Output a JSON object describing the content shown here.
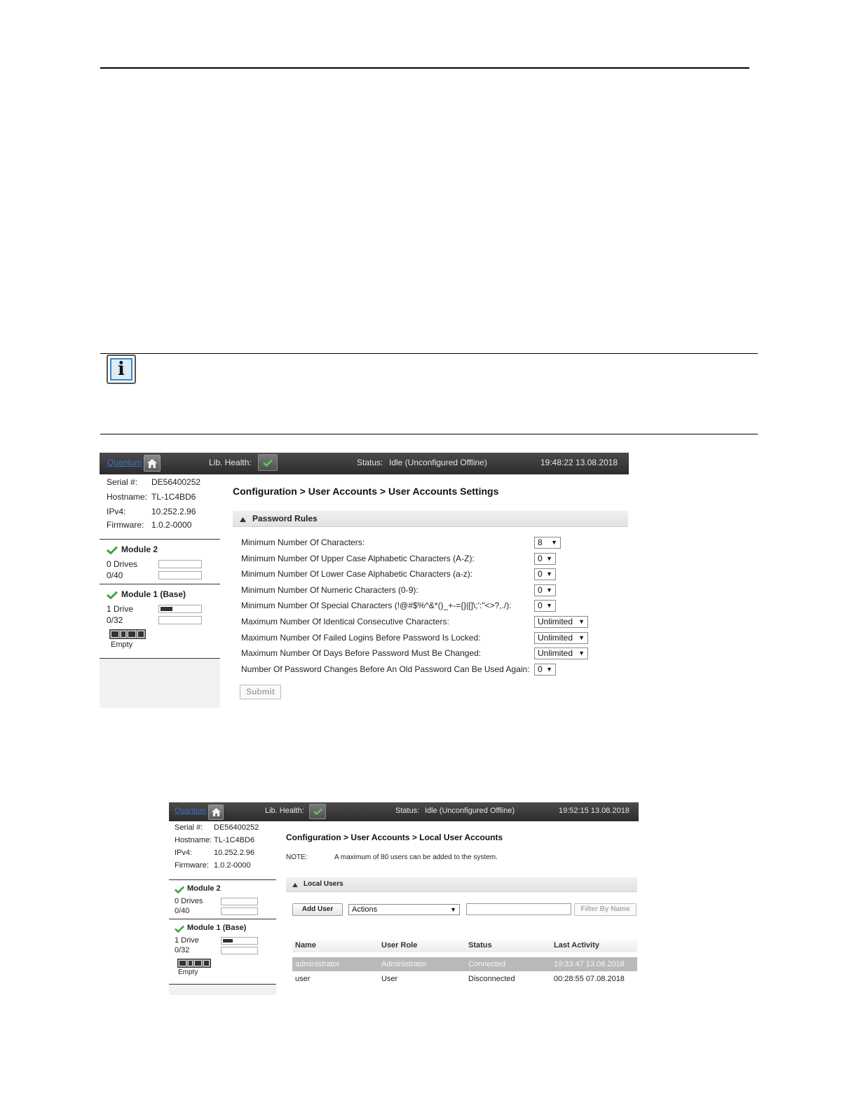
{
  "info_icon": {
    "glyph": "i"
  },
  "screen1": {
    "topbar": {
      "logo": "Quantum",
      "health_label": "Lib. Health:",
      "status_label": "Status:",
      "status_value": "Idle (Unconfigured Offline)",
      "datetime": "19:48:22  13.08.2018"
    },
    "sidebar": {
      "serial_label": "Serial #:",
      "serial_value": "DE56400252",
      "hostname_label": "Hostname:",
      "hostname_value": "TL-1C4BD6",
      "ipv4_label": "IPv4:",
      "ipv4_value": "10.252.2.96",
      "firmware_label": "Firmware:",
      "firmware_value": "1.0.2-0000",
      "module2": {
        "title": "Module 2",
        "drives": "0 Drives",
        "slots": "0/40"
      },
      "module1": {
        "title": "Module 1 (Base)",
        "drives": "1 Drive",
        "slots": "0/32",
        "drive_fill": 0.35,
        "cart_label": "Empty"
      }
    },
    "breadcrumb": "Configuration > User Accounts > User Accounts Settings",
    "panel_title": "Password Rules",
    "rules": [
      {
        "label": "Minimum Number Of Characters:",
        "value": "8"
      },
      {
        "label": "Minimum Number Of Upper Case Alphabetic Characters (A-Z):",
        "value": "0"
      },
      {
        "label": "Minimum Number Of Lower Case Alphabetic Characters (a-z):",
        "value": "0"
      },
      {
        "label": "Minimum Number Of Numeric Characters (0-9):",
        "value": "0"
      },
      {
        "label": "Minimum Number Of Special Characters (!@#$%^&*()_+-={}|[]\\;':\"<>?,./):",
        "value": "0"
      },
      {
        "label": "Maximum Number Of Identical Consecutive Characters:",
        "value": "Unlimited"
      },
      {
        "label": "Maximum Number Of Failed Logins Before Password Is Locked:",
        "value": "Unlimited"
      },
      {
        "label": "Maximum Number Of Days Before Password Must Be Changed:",
        "value": "Unlimited"
      },
      {
        "label": "Number Of Password Changes Before An Old Password Can Be Used Again:",
        "value": "0"
      }
    ],
    "submit_label": "Submit"
  },
  "screen2": {
    "topbar": {
      "logo": "Quantum",
      "health_label": "Lib. Health:",
      "status_label": "Status:",
      "status_value": "Idle (Unconfigured Offline)",
      "datetime": "19:52:15  13.08.2018"
    },
    "sidebar": {
      "serial_label": "Serial #:",
      "serial_value": "DE56400252",
      "hostname_label": "Hostname:",
      "hostname_value": "TL-1C4BD6",
      "ipv4_label": "IPv4:",
      "ipv4_value": "10.252.2.96",
      "firmware_label": "Firmware:",
      "firmware_value": "1.0.2-0000",
      "module2": {
        "title": "Module 2",
        "drives": "0 Drives",
        "slots": "0/40"
      },
      "module1": {
        "title": "Module 1 (Base)",
        "drives": "1 Drive",
        "slots": "0/32",
        "drive_fill": 0.35,
        "cart_label": "Empty"
      }
    },
    "breadcrumb": "Configuration > User Accounts > Local User Accounts",
    "note_label": "NOTE:",
    "note_text": "A maximum of 80 users can be added to the system.",
    "panel_title": "Local Users",
    "add_user_label": "Add User",
    "actions_value": "Actions",
    "filter_placeholder": "",
    "filter_button": "Filter By Name",
    "columns": [
      "Name",
      "User Role",
      "Status",
      "Last Activity"
    ],
    "users": [
      {
        "name": "administrator",
        "role": "Administrator",
        "status": "Connected",
        "last": "19:33:47  13.08.2018"
      },
      {
        "name": "user",
        "role": "User",
        "status": "Disconnected",
        "last": "00:28:55  07.08.2018"
      }
    ]
  }
}
